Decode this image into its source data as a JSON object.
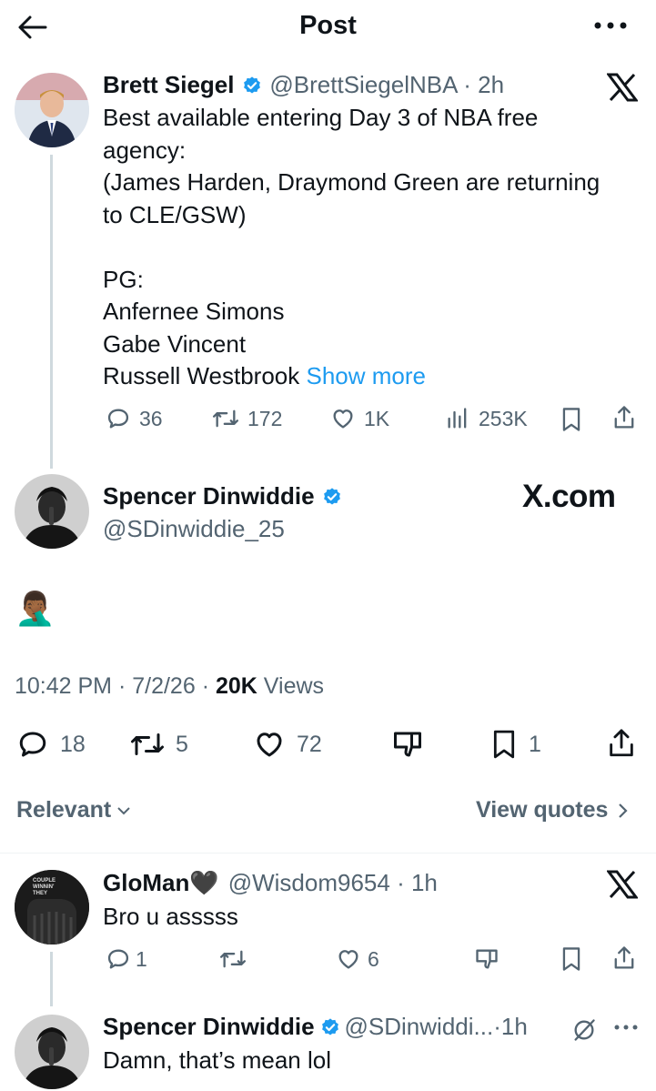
{
  "header": {
    "title": "Post"
  },
  "parent": {
    "name": "Brett Siegel",
    "handle": "@BrettSiegelNBA",
    "time": "2h",
    "lines": [
      "Best available entering Day 3 of NBA free",
      "agency:",
      "(James Harden, Draymond Green are returning",
      "to CLE/GSW)",
      "",
      "PG:",
      "Anfernee Simons",
      "Gabe Vincent"
    ],
    "last_line": "Russell Westbrook",
    "show_more": "Show more",
    "replies": "36",
    "reposts": "172",
    "likes": "1K",
    "views": "253K"
  },
  "main": {
    "name": "Spencer Dinwiddie",
    "handle": "@SDinwiddie_25",
    "watermark": "X.com",
    "emoji": "🤦🏾‍♂️",
    "time": "10:42 PM",
    "date": "7/2/26",
    "views_count": "20K",
    "views_label": "Views",
    "replies": "18",
    "reposts": "5",
    "likes": "72",
    "bookmarks": "1"
  },
  "filter": {
    "relevant": "Relevant",
    "view_quotes": "View quotes"
  },
  "reply1": {
    "name": "GloMan🖤",
    "handle": "@Wisdom9654",
    "time": "1h",
    "text": "Bro u asssss",
    "replies": "1",
    "likes": "6",
    "avatar_text": "COUPLE WINNIN' THEY"
  },
  "reply2": {
    "name": "Spencer Dinwiddie",
    "handle": "@SDinwiddi...",
    "time": "1h",
    "text": "Damn, that’s mean lol"
  },
  "colors": {
    "accent": "#1d9bf0",
    "muted": "#536471",
    "text": "#0f1419",
    "line": "#cfd9de"
  }
}
